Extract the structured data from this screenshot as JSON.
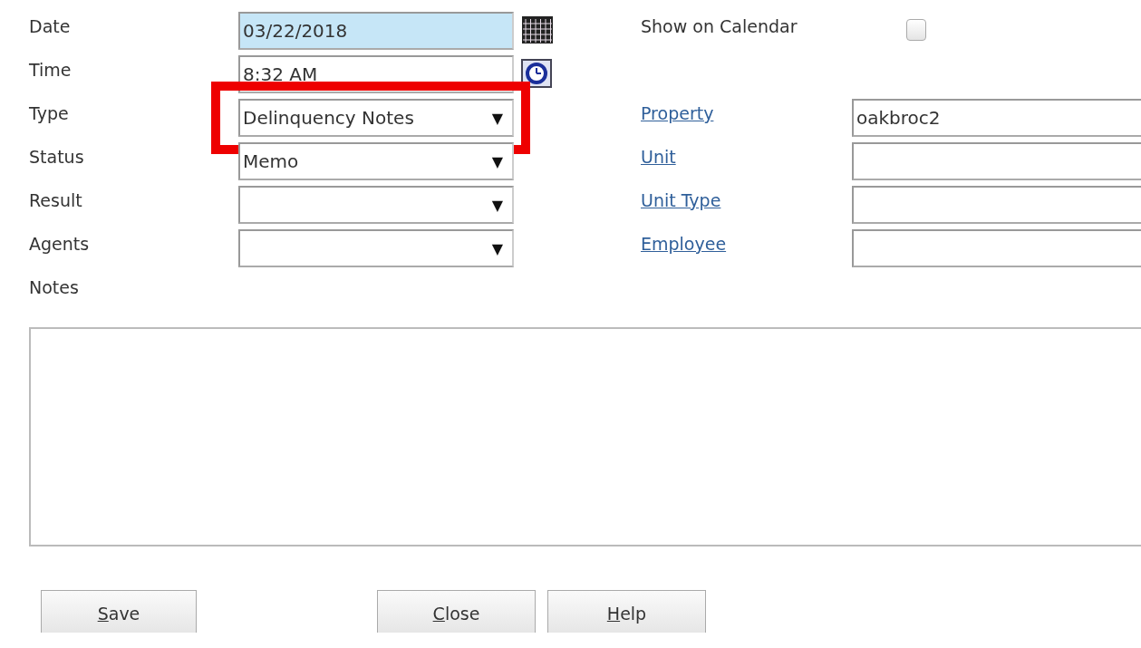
{
  "form": {
    "left_rows": [
      {
        "label": "Date",
        "kind": "text",
        "value": "03/22/2018",
        "selected": true
      },
      {
        "label": "Time",
        "kind": "text",
        "value": "8:32 AM",
        "selected": false
      },
      {
        "label": "Type",
        "kind": "select",
        "value": "Delinquency Notes",
        "arrow": "▼",
        "highlighted": true
      },
      {
        "label": "Status",
        "kind": "select",
        "value": "Memo",
        "arrow": "▼",
        "highlighted": false
      },
      {
        "label": "Result",
        "kind": "select",
        "arrow": "▼",
        "highlighted": false
      },
      {
        "label": "Agents",
        "kind": "select",
        "arrow": "▼",
        "highlighted": false
      }
    ],
    "show_on_calendar": {
      "label": "Show on Calendar",
      "checked": false
    },
    "right_rows": [
      {
        "label": "Property",
        "value": "oakbroc2"
      },
      {
        "label": "Unit"
      },
      {
        "label": "Unit Type"
      },
      {
        "label": "Employee"
      }
    ],
    "notes": {
      "label": "Notes"
    }
  },
  "buttons": [
    {
      "label": "Save"
    },
    {
      "label": "Close"
    },
    {
      "label": "Help"
    }
  ]
}
